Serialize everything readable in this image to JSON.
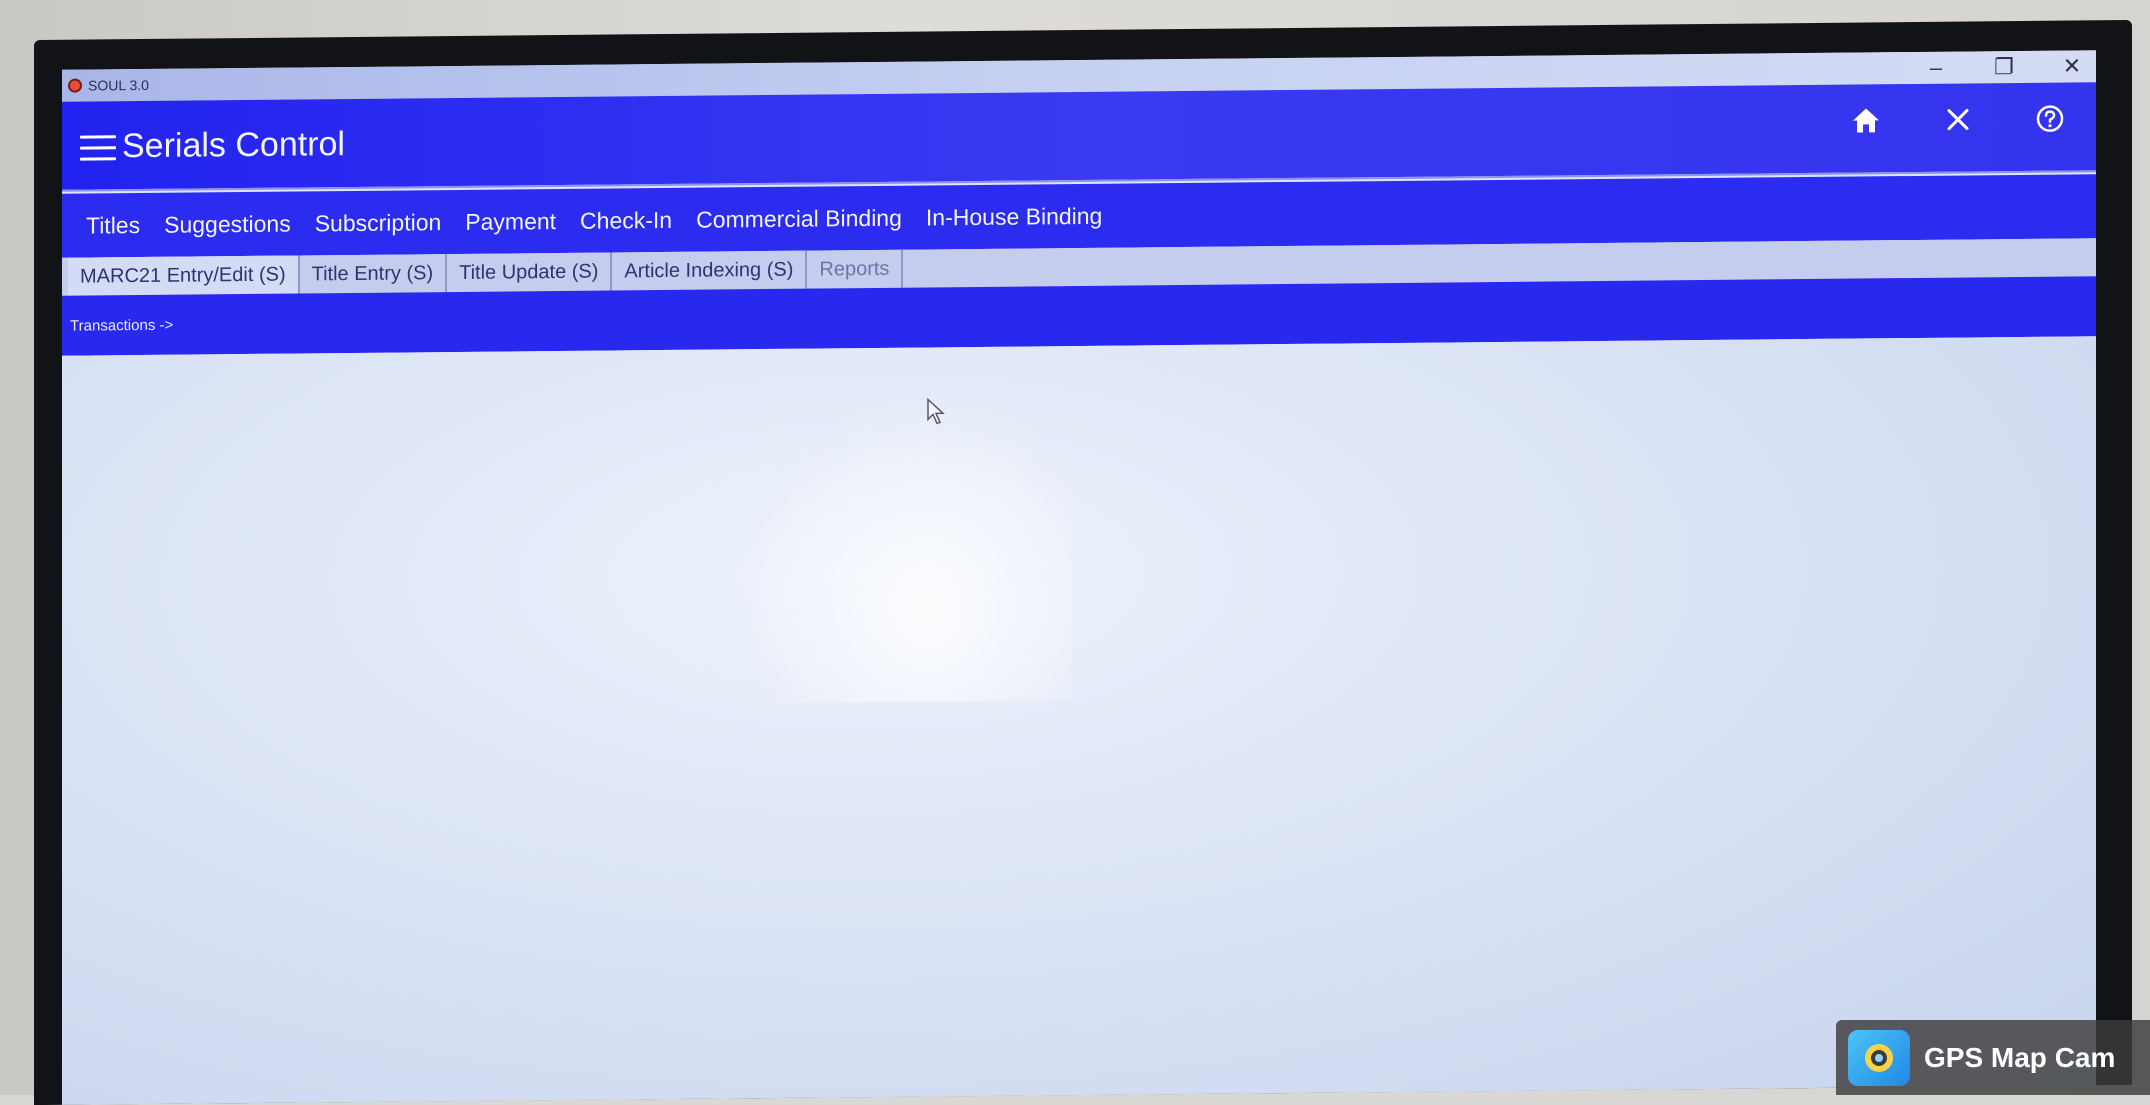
{
  "window": {
    "os_title": "SOUL 3.0",
    "controls": [
      "–",
      "❐",
      "✕"
    ]
  },
  "header": {
    "title": "Serials Control",
    "icons": [
      "home-icon",
      "close-icon",
      "help-icon"
    ]
  },
  "main_nav": {
    "items": [
      "Titles",
      "Suggestions",
      "Subscription",
      "Payment",
      "Check-In",
      "Commercial Binding",
      "In-House Binding"
    ]
  },
  "sub_nav": {
    "items": [
      "MARC21 Entry/Edit (S)",
      "Title Entry (S)",
      "Title Update (S)",
      "Article Indexing (S)",
      "Reports"
    ]
  },
  "breadcrumb": {
    "label": "Transactions ->"
  },
  "watermark": {
    "text": "GPS Map Cam"
  },
  "colors": {
    "header_blue": "#2222f0",
    "nav_blue": "#2c2cf0",
    "subnav_bg": "#c4cdee",
    "content_bg": "#dbe4f5"
  }
}
